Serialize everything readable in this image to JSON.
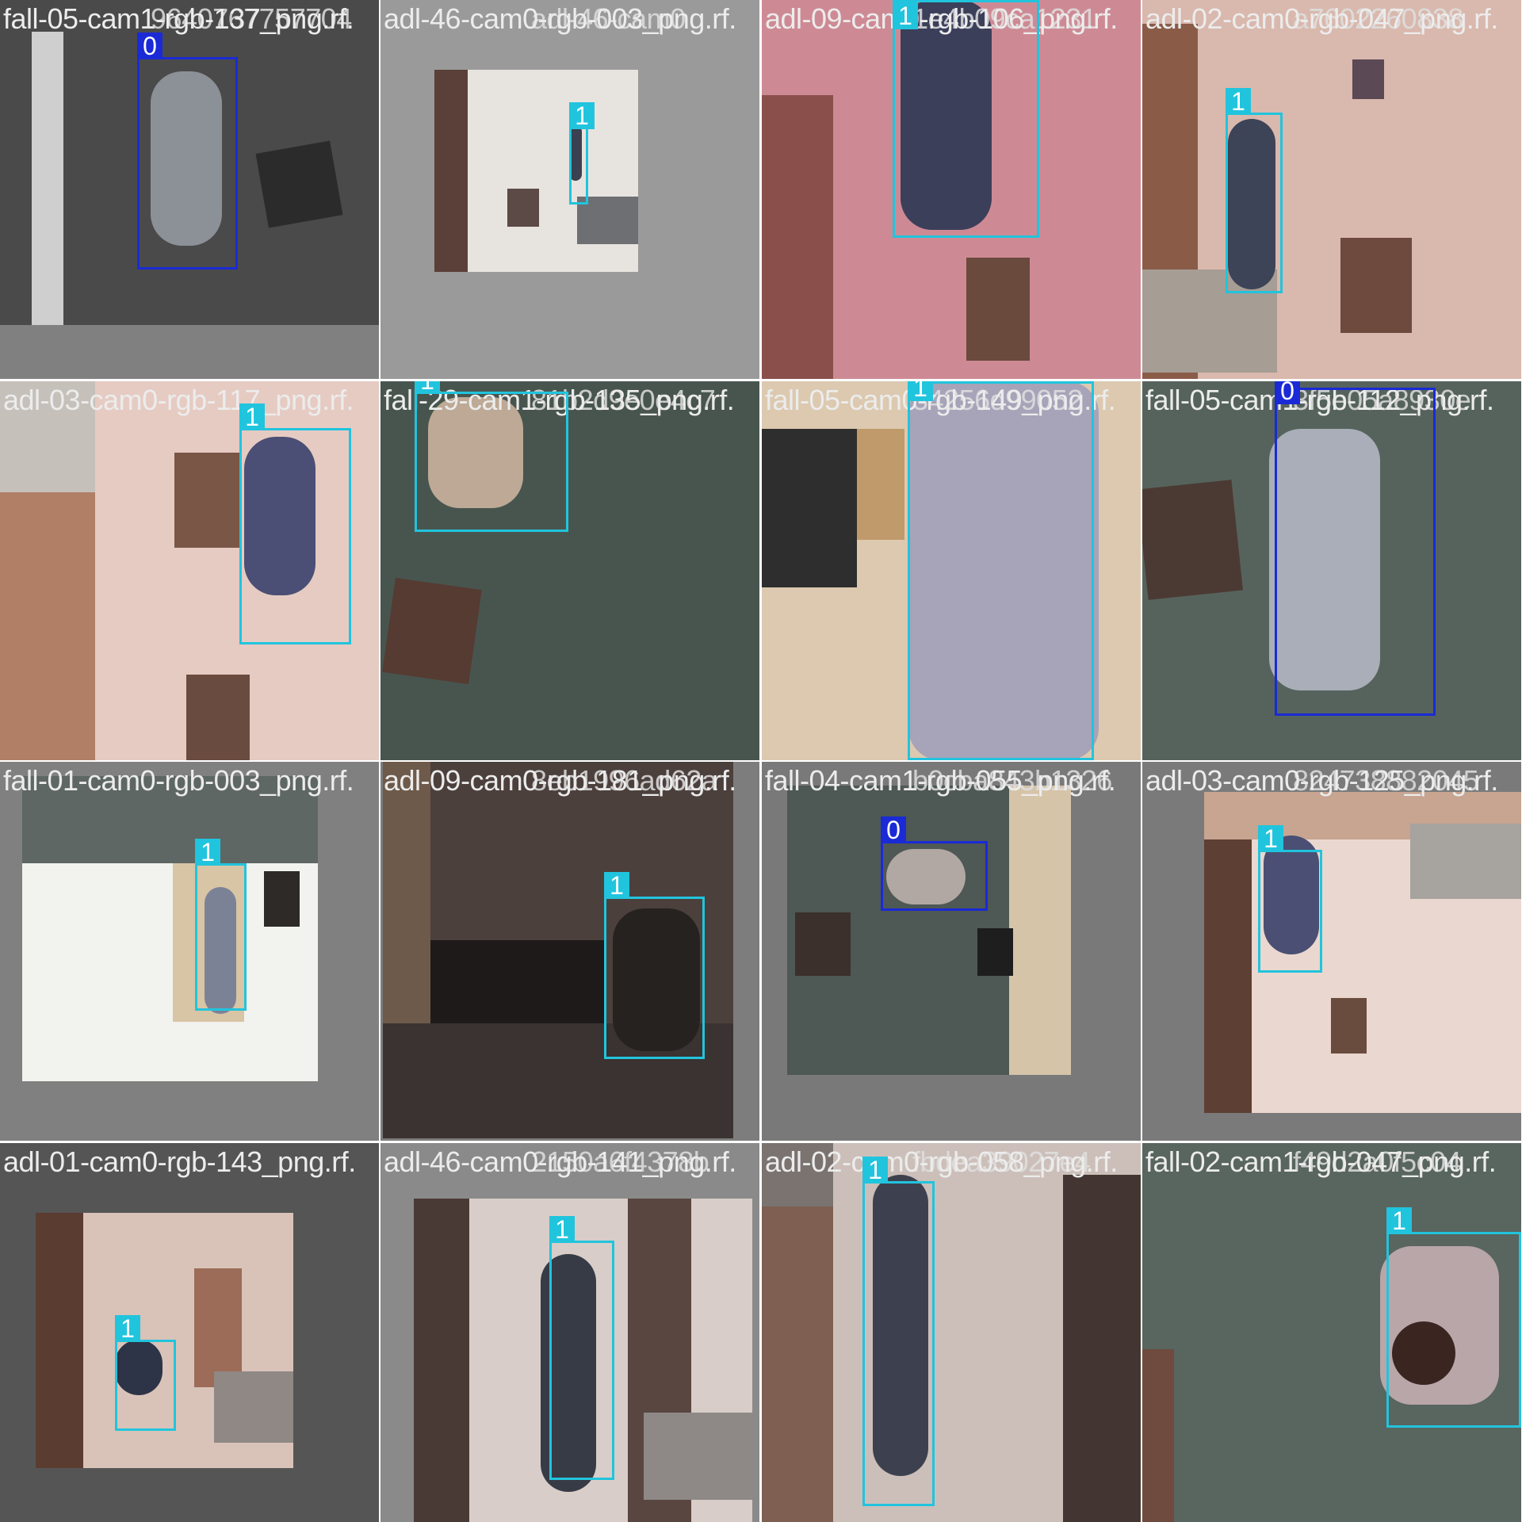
{
  "tiles": [
    {
      "name": "fall-05-cam1-rgb-137_png.rf.",
      "overlap": "9640767757704",
      "class_label": "0"
    },
    {
      "name": "adl-46-cam0-rgb-003_png.rf.",
      "overlap": "adl-46-cam0",
      "class_label": "1"
    },
    {
      "name": "adl-09-cam0-rgb-106_png.rf.",
      "overlap": "1e4b09ca1231",
      "class_label": "1"
    },
    {
      "name": "adl-02-cam0-rgb-047_png.rf.",
      "overlap": "a7602260838",
      "class_label": "1"
    },
    {
      "name": "adl-03-cam0-rgb-117_png.rf.",
      "overlap": "",
      "class_label": "1"
    },
    {
      "name": "fall-29-cam1-rgb-135_png.rf.",
      "overlap": "81b2d9e0e4c7",
      "class_label": "1"
    },
    {
      "name": "fall-05-cam0-rgb-149_png.rf.",
      "overlap": "34256d99052",
      "class_label": "1"
    },
    {
      "name": "fall-05-cam1-rgb-112_png.rf.",
      "overlap": "3f5e05a8930e",
      "class_label": "0"
    },
    {
      "name": "fall-01-cam0-rgb-003_png.rf.",
      "overlap": "",
      "class_label": "1"
    },
    {
      "name": "adl-09-cam0-rgb-181_png.rf.",
      "overlap": "8eb1996ad62a",
      "class_label": "1"
    },
    {
      "name": "fall-04-cam1-rgb-055_png.rf.",
      "overlap": "b0cba843b1326",
      "class_label": "0"
    },
    {
      "name": "adl-03-cam0-rgb-125_png.rf.",
      "overlap": "824738882045",
      "class_label": "1"
    },
    {
      "name": "adl-01-cam0-rgb-143_png.rf.",
      "overlap": "",
      "class_label": "1"
    },
    {
      "name": "adl-46-cam0-rgb-141_png.rf.",
      "overlap": "2150a6f4378b",
      "class_label": "1"
    },
    {
      "name": "adl-02-cam0-rgb-058_png.rf.",
      "overlap": "fbdea39027e4",
      "class_label": "1"
    },
    {
      "name": "fall-02-cam1-rgb-047_png.rf.",
      "overlap": "f49d2a0f5c04",
      "class_label": "1"
    }
  ],
  "colors": {
    "class_0": "#1a2ad6",
    "class_1": "#21c4dd"
  }
}
